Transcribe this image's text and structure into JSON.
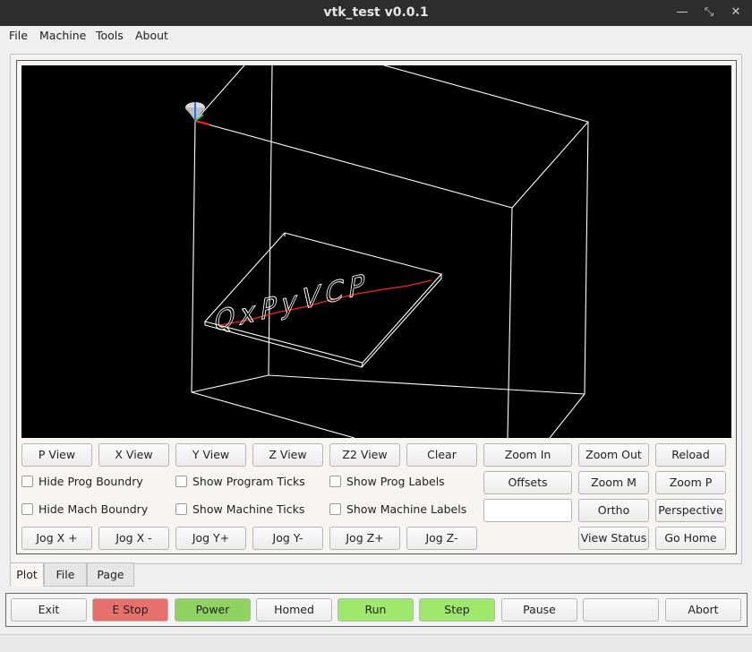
{
  "window": {
    "title": "vtk_test v0.0.1",
    "controls": {
      "minimize": "—",
      "restore": "⤡",
      "close": "✕"
    }
  },
  "menus": [
    "File",
    "Machine",
    "Tools",
    "About"
  ],
  "viewer": {
    "engraving_text": "QxPyVCP",
    "colors": {
      "background": "#000000",
      "wireframe": "#ffffff",
      "toolpath": "#ff2020"
    }
  },
  "buttons_row1": [
    "P View",
    "X View",
    "Y View",
    "Z View",
    "Z2 View",
    "Clear",
    "Zoom In",
    "Zoom Out",
    "Reload"
  ],
  "checkboxes": {
    "row2": [
      "Hide Prog Boundry",
      "Show Program Ticks",
      "Show Prog Labels"
    ],
    "row3": [
      "Hide Mach Boundry",
      "Show Machine Ticks",
      "Show Machine Labels"
    ]
  },
  "buttons_row2": [
    "Offsets",
    "Zoom M",
    "Zoom P"
  ],
  "buttons_row3": [
    "Ortho",
    "Perspective"
  ],
  "offset_input": {
    "value": "",
    "placeholder": ""
  },
  "jog_buttons": [
    "Jog X +",
    "Jog X -",
    "Jog Y+",
    "Jog Y-",
    "Jog Z+",
    "Jog Z-"
  ],
  "buttons_row4": [
    "View Status",
    "Go Home"
  ],
  "tabs": [
    "Plot",
    "File",
    "Page"
  ],
  "bottom_buttons": [
    "Exit",
    "E Stop",
    "Power",
    "Homed",
    "Run",
    "Step",
    "Pause",
    "",
    "Abort"
  ],
  "colors": {
    "estop": "#e8706c",
    "power": "#8fd260",
    "run": "#9ee86b",
    "step": "#9ee86b",
    "default": "#f3f3f3"
  }
}
